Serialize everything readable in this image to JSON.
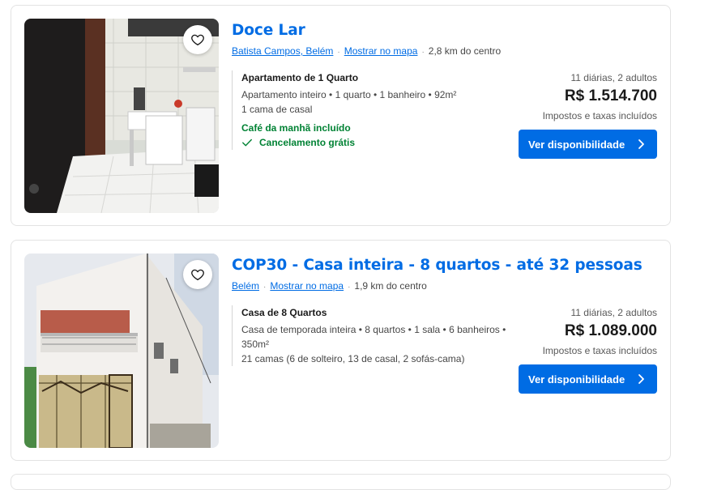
{
  "listings": [
    {
      "title": "Doce Lar",
      "location": "Batista Campos, Belém",
      "map_link": "Mostrar no mapa",
      "distance": "2,8 km do centro",
      "unit_title": "Apartamento de 1 Quarto",
      "details_1": "Apartamento inteiro • 1 quarto • 1 banheiro • 92m²",
      "details_2": "1 cama de casal",
      "breakfast": "Café da manhã incluído",
      "cancellation": "Cancelamento grátis",
      "nights_guests": "11 diárias, 2 adultos",
      "price": "R$ 1.514.700",
      "taxes": "Impostos e taxas incluídos",
      "cta": "Ver disponibilidade"
    },
    {
      "title": "COP30 - Casa inteira - 8 quartos - até 32 pessoas",
      "location": "Belém",
      "map_link": "Mostrar no mapa",
      "distance": "1,9 km do centro",
      "unit_title": "Casa de 8 Quartos",
      "details_1": "Casa de temporada inteira • 8 quartos • 1 sala • 6 banheiros • 350m²",
      "details_2": "21 camas (6 de solteiro, 13 de casal, 2 sofás-cama)",
      "nights_guests": "11 diárias, 2 adultos",
      "price": "R$ 1.089.000",
      "taxes": "Impostos e taxas incluídos",
      "cta": "Ver disponibilidade"
    }
  ],
  "colors": {
    "link_blue": "#006ce4",
    "green": "#008234",
    "button_blue": "#006ce4"
  },
  "icons": [
    "heart-outline-icon",
    "checkmark-icon",
    "chevron-right-icon"
  ]
}
